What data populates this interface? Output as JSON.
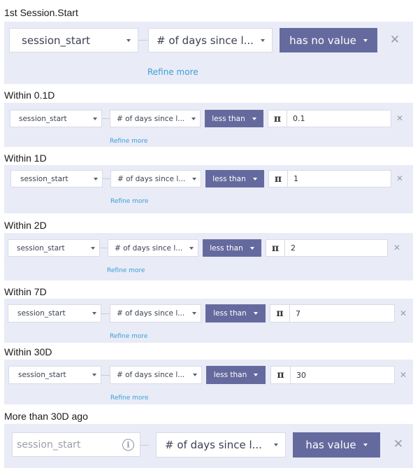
{
  "sections": [
    {
      "title": "1st Session.Start",
      "event": "session_start",
      "property": "# of days since l...",
      "operator": "has no value",
      "refine": "Refine more"
    },
    {
      "title": "Within 0.1D",
      "event": "session_start",
      "property": "# of days since l...",
      "operator": "less than",
      "pi_symbol": "π",
      "value": "0.1",
      "refine": "Refine more"
    },
    {
      "title": "Within 1D",
      "event": "session_start",
      "property": "# of days since l...",
      "operator": "less than",
      "pi_symbol": "π",
      "value": "1",
      "refine": "Refine more"
    },
    {
      "title": "Within 2D",
      "event": "session_start",
      "property": "# of days since l...",
      "operator": "less than",
      "pi_symbol": "π",
      "value": "2",
      "refine": "Refine more"
    },
    {
      "title": "Within 7D",
      "event": "session_start",
      "property": "# of days since l...",
      "operator": "less than",
      "pi_symbol": "π",
      "value": "7",
      "refine": "Refine more"
    },
    {
      "title": "Within 30D",
      "event": "session_start",
      "property": "# of days since l...",
      "operator": "less than",
      "pi_symbol": "π",
      "value": "30",
      "refine": "Refine more"
    },
    {
      "title": "More than 30D ago",
      "event_placeholder": "session_start",
      "info_glyph": "i",
      "property": "# of days since l...",
      "operator": "has value"
    }
  ],
  "close_glyph": "✕",
  "colors": {
    "panel_bg": "#e9ebf6",
    "operator_bg": "#656a9e",
    "refine_link": "#3aa0d6"
  },
  "icons": [
    "chevron-down-icon",
    "close-icon",
    "pi-icon",
    "info-icon"
  ]
}
